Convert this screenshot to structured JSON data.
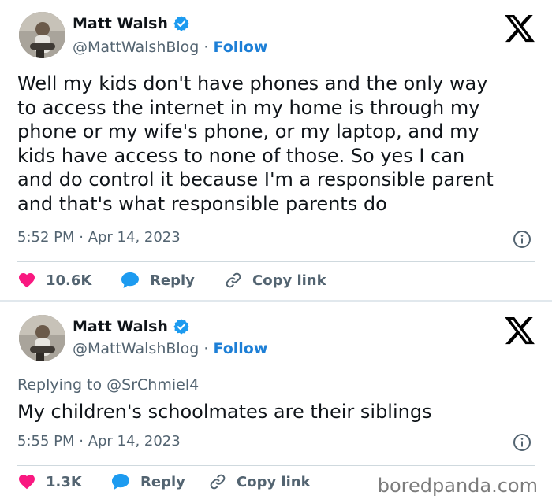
{
  "tweets": [
    {
      "author": {
        "name": "Matt Walsh",
        "handle": "@MattWalshBlog",
        "separator": " · ",
        "follow_label": "Follow"
      },
      "body": "Well my kids don't have phones and the only way\nto access the internet in my home is through my\nphone or my wife's phone, or my laptop, and my\nkids have access to none of those. So yes I can\nand do control it because I'm a responsible parent\nand that's what responsible parents do",
      "timestamp": "5:52 PM · Apr 14, 2023",
      "actions": {
        "likes": "10.6K",
        "reply_label": "Reply",
        "copy_link_label": "Copy link"
      }
    },
    {
      "author": {
        "name": "Matt Walsh",
        "handle": "@MattWalshBlog",
        "separator": " · ",
        "follow_label": "Follow"
      },
      "replying_to": {
        "prefix": "Replying to ",
        "mention": "@SrChmiel4"
      },
      "body": "My children's schoolmates are their siblings",
      "timestamp": "5:55 PM · Apr 14, 2023",
      "actions": {
        "likes": "1.3K",
        "reply_label": "Reply",
        "copy_link_label": "Copy link"
      }
    }
  ],
  "watermark": "boredpanda.com",
  "colors": {
    "like_pink": "#f91880",
    "reply_blue": "#1d9bf0",
    "follow_blue": "#1d7fd6",
    "verified_blue": "#1d9bf0",
    "secondary_text": "#536471",
    "primary_text": "#0f1419"
  },
  "icons": [
    "verified-badge-icon",
    "x-logo-icon",
    "info-icon",
    "heart-icon",
    "reply-bubble-icon",
    "link-icon"
  ]
}
